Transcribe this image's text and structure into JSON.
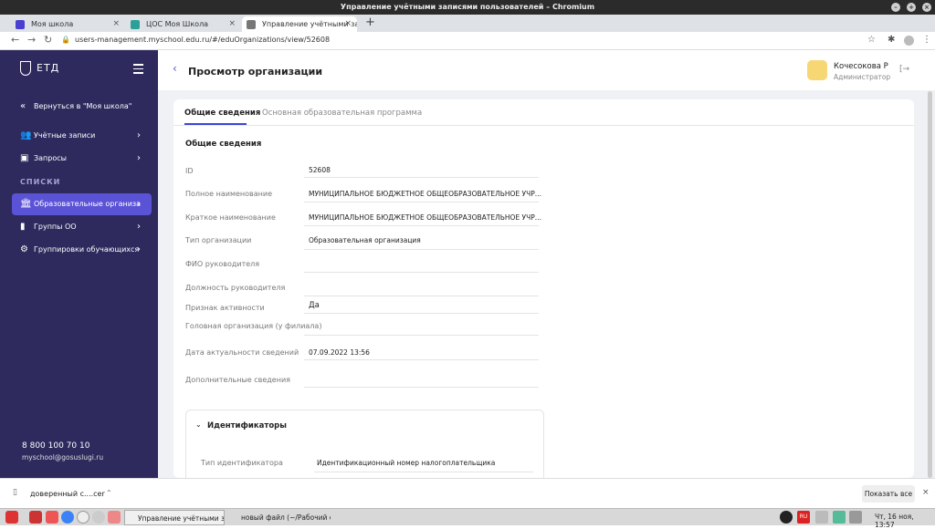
{
  "window": {
    "title": "Управление учётными записями пользователей – Chromium"
  },
  "tabs": [
    {
      "label": "Моя школа",
      "color": "#4b3fd1"
    },
    {
      "label": "ЦОС Моя Школа",
      "color": "#2aa198"
    },
    {
      "label": "Управление учётными запис",
      "color": "#777777"
    }
  ],
  "address": {
    "url": "users-management.myschool.edu.ru/#/eduOrganizations/view/52608"
  },
  "sidebar": {
    "logo": "ЕТД",
    "back": "Вернуться в \"Моя школа\"",
    "items": [
      {
        "label": "Учётные записи",
        "icon": "users-icon"
      },
      {
        "label": "Запросы",
        "icon": "inbox-icon"
      }
    ],
    "section": "СПИСКИ",
    "list_items": [
      {
        "label": "Образовательные организа",
        "icon": "building-icon",
        "active": true
      },
      {
        "label": "Группы ОО",
        "icon": "bookmark-icon"
      },
      {
        "label": "Группировки обучающихся",
        "icon": "gear-icon"
      }
    ],
    "phone": "8 800 100 70 10",
    "email": "myschool@gosuslugi.ru"
  },
  "header": {
    "title": "Просмотр организации",
    "user_name": "Кочесокова Р",
    "user_role": "Администратор"
  },
  "content_tabs": [
    "Общие сведения",
    "Основная образовательная программа"
  ],
  "section_title": "Общие сведения",
  "fields": [
    {
      "label": "ID",
      "value": "52608"
    },
    {
      "label": "Полное наименование",
      "value": "МУНИЦИПАЛЬНОЕ БЮДЖЕТНОЕ ОБЩЕОБРАЗОВАТЕЛЬНОЕ УЧР..."
    },
    {
      "label": "Краткое наименование",
      "value": "МУНИЦИПАЛЬНОЕ БЮДЖЕТНОЕ ОБЩЕОБРАЗОВАТЕЛЬНОЕ УЧР..."
    },
    {
      "label": "Тип организации",
      "value": "Образовательная организация"
    },
    {
      "label": "ФИО руководителя",
      "value": ""
    },
    {
      "label": "Должность руководителя",
      "value": ""
    },
    {
      "label": "Признак активности",
      "value": "Да"
    },
    {
      "label": "Головная организация (у филиала)",
      "value": ""
    },
    {
      "label": "Дата актуальности сведений",
      "value": "07.09.2022 13:56"
    },
    {
      "label": "Дополнительные сведения",
      "value": ""
    }
  ],
  "identifiers": {
    "title": "Идентификаторы",
    "label": "Тип идентификатора",
    "value": "Идентификационный номер налогоплательщика"
  },
  "download": {
    "file": "доверенный с....cer",
    "show_all": "Показать все"
  },
  "taskbar": {
    "win1": "Управление учётными запи...",
    "win2": "новый файл (~/Рабочий ст...",
    "lang": "RU",
    "clock": "Чт, 16 ноя, 13:57"
  }
}
